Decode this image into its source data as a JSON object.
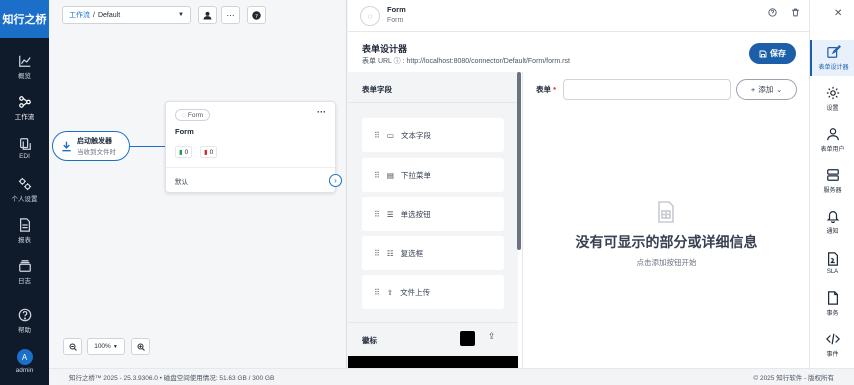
{
  "app": {
    "brand": "知行之桥"
  },
  "leftnav": {
    "items": [
      {
        "label": "概览",
        "icon": "chart-line-icon"
      },
      {
        "label": "工作流",
        "icon": "workflow-icon"
      },
      {
        "label": "EDI",
        "icon": "edi-icon"
      },
      {
        "label": "个人设置",
        "icon": "settings-icon"
      },
      {
        "label": "报表",
        "icon": "report-icon"
      },
      {
        "label": "日志",
        "icon": "log-icon"
      }
    ],
    "help": "帮助",
    "user": "admin",
    "avatar": "A"
  },
  "canvas": {
    "breadcrumb_root": "工作流",
    "breadcrumb_sep": "/",
    "workspace": "Default",
    "trigger_title": "启动触发器",
    "trigger_sub": "当收到文件时",
    "node": {
      "pill": "Form",
      "title": "Form",
      "ok_count": "0",
      "err_count": "0",
      "default_label": "默认"
    },
    "zoom": "100%"
  },
  "panel": {
    "header_title": "Form",
    "header_sub": "Form",
    "designer_title": "表单设计器",
    "url_label": "表单 URL ⓘ :",
    "url": "http://localhost:8080/connector/Default/Form/form.rst",
    "save": "保存",
    "fields_title": "表单字段",
    "fields": [
      {
        "label": "文本字段",
        "icon": "text-field-icon"
      },
      {
        "label": "下拉菜单",
        "icon": "dropdown-icon"
      },
      {
        "label": "单选按钮",
        "icon": "radio-list-icon"
      },
      {
        "label": "复选框",
        "icon": "checkbox-list-icon"
      },
      {
        "label": "文件上传",
        "icon": "upload-icon"
      }
    ],
    "badge_label": "徽标",
    "form_label": "表单",
    "required_mark": "*",
    "add": "添加",
    "empty_title": "没有可显示的部分或详细信息",
    "empty_sub": "点击添加按钮开始"
  },
  "rail": {
    "items": [
      {
        "label": "表单设计器",
        "icon": "form-designer-icon"
      },
      {
        "label": "设置",
        "icon": "gear-icon"
      },
      {
        "label": "表单用户",
        "icon": "user-icon"
      },
      {
        "label": "服务器",
        "icon": "server-icon"
      },
      {
        "label": "通知",
        "icon": "bell-icon"
      },
      {
        "label": "SLA",
        "icon": "sla-icon"
      },
      {
        "label": "事务",
        "icon": "transaction-icon"
      },
      {
        "label": "事件",
        "icon": "code-icon"
      }
    ]
  },
  "footer": {
    "left": "知行之桥™ 2025 - 25.3.9306.0 • 磁盘空间使用情况: 51.63 GB / 300 GB",
    "right": "© 2025 知行软件 - 版权所有"
  }
}
